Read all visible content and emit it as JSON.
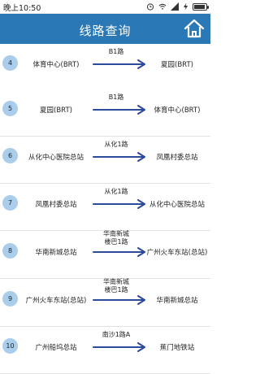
{
  "status_bar": {
    "time": "晚上10:50"
  },
  "header": {
    "title": "线路查询"
  },
  "rows": [
    {
      "num": "4",
      "start": "体育中心(BRT)",
      "route": "B1路",
      "end": "夏园(BRT)"
    },
    {
      "num": "5",
      "start": "夏园(BRT)",
      "route": "B1路",
      "end": "体育中心(BRT)"
    },
    {
      "num": "6",
      "start": "从化中心医院总站",
      "route": "从化1路",
      "end": "凤凰村委总站"
    },
    {
      "num": "7",
      "start": "凤凰村委总站",
      "route": "从化1路",
      "end": "从化中心医院总站"
    },
    {
      "num": "8",
      "start": "华南新城总站",
      "route": "华南新城\n楼巴1路",
      "end": "广州火车东站(总站)"
    },
    {
      "num": "9",
      "start": "广州火车东站(总站)",
      "route": "华南新城\n楼巴1路",
      "end": "华南新城总站"
    },
    {
      "num": "10",
      "start": "广州船坞总站",
      "route": "南沙1路A",
      "end": "蕉门地铁站"
    }
  ],
  "colors": {
    "header": "#2b78b6",
    "arrow": "#2b4b9a",
    "badge": "#a9cdeb"
  }
}
